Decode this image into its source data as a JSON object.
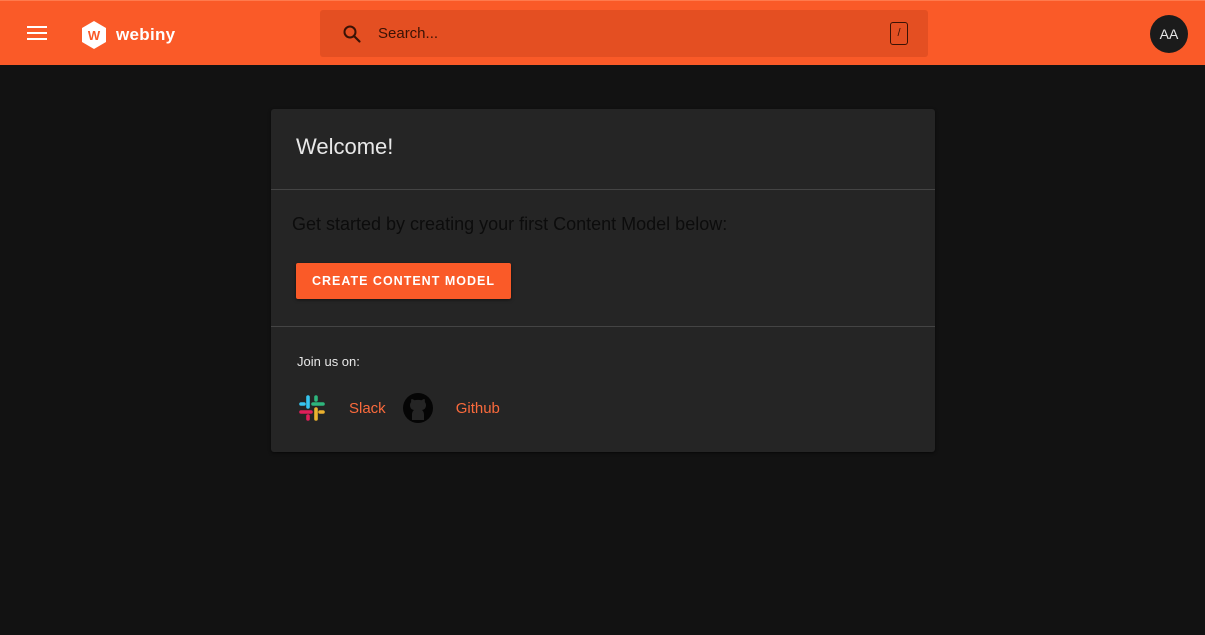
{
  "header": {
    "brand": "webiny",
    "logo_letter": "W",
    "menu_icon": "hamburger-menu-icon",
    "search": {
      "placeholder": "Search...",
      "shortcut": "/"
    },
    "avatar_initials": "AA"
  },
  "welcome": {
    "title": "Welcome!",
    "intro": "Get started by creating your first Content Model below:",
    "create_button": "CREATE CONTENT MODEL"
  },
  "community": {
    "label": "Join us on:",
    "links": [
      {
        "label": "Slack",
        "icon": "slack-icon"
      },
      {
        "label": "Github",
        "icon": "github-icon"
      }
    ]
  },
  "colors": {
    "brand_orange": "#fa5a28",
    "background": "#121212",
    "card": "#252525",
    "link": "#fa6a3c"
  }
}
